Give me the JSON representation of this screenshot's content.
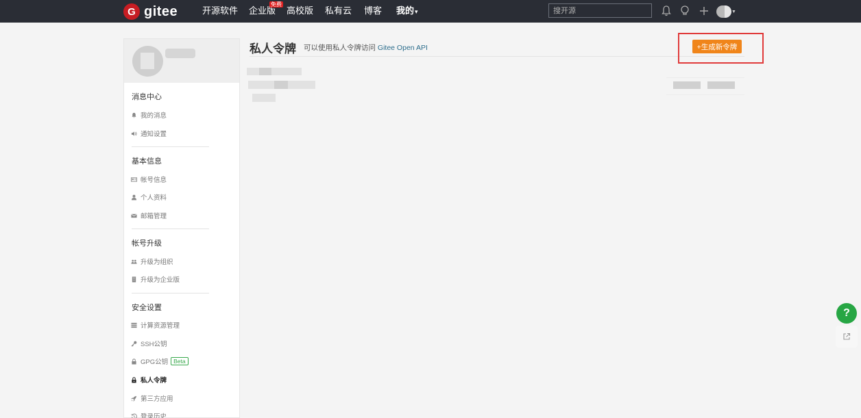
{
  "brand": {
    "name": "gitee",
    "mark": "G"
  },
  "nav": {
    "items": [
      "开源软件",
      "企业版",
      "高校版",
      "私有云",
      "博客",
      "我的"
    ],
    "enterprise_badge": "免费",
    "mine_caret": "▾"
  },
  "search": {
    "placeholder": "搜开源"
  },
  "sidebar": {
    "sections": [
      {
        "title": "消息中心",
        "items": [
          {
            "label": "我的消息",
            "icon": "bell-icon"
          },
          {
            "label": "通知设置",
            "icon": "speaker-icon"
          }
        ]
      },
      {
        "title": "基本信息",
        "items": [
          {
            "label": "帐号信息",
            "icon": "id-card-icon"
          },
          {
            "label": "个人资料",
            "icon": "user-icon"
          },
          {
            "label": "邮箱管理",
            "icon": "mail-icon"
          }
        ]
      },
      {
        "title": "帐号升级",
        "items": [
          {
            "label": "升级为组织",
            "icon": "group-icon"
          },
          {
            "label": "升级为企业版",
            "icon": "building-icon"
          }
        ]
      },
      {
        "title": "安全设置",
        "items": [
          {
            "label": "计算资源管理",
            "icon": "server-icon"
          },
          {
            "label": "SSH公钥",
            "icon": "key-icon"
          },
          {
            "label": "GPG公钥",
            "icon": "lock-icon",
            "badge": "Beta"
          },
          {
            "label": "私人令牌",
            "icon": "lock-icon",
            "active": true
          },
          {
            "label": "第三方应用",
            "icon": "rocket-icon"
          },
          {
            "label": "登录历史",
            "icon": "history-icon"
          }
        ]
      }
    ]
  },
  "main": {
    "title": "私人令牌",
    "description_prefix": "可以使用私人令牌访问",
    "description_link": "Gitee Open API",
    "generate_button": "+生成新令牌"
  },
  "floating": {
    "help": "?"
  },
  "colors": {
    "nav_bg": "#2a2d35",
    "brand_red": "#c71d23",
    "accent_orange": "#f0851a",
    "highlight_red": "#e03a3a",
    "help_green": "#27a644"
  }
}
